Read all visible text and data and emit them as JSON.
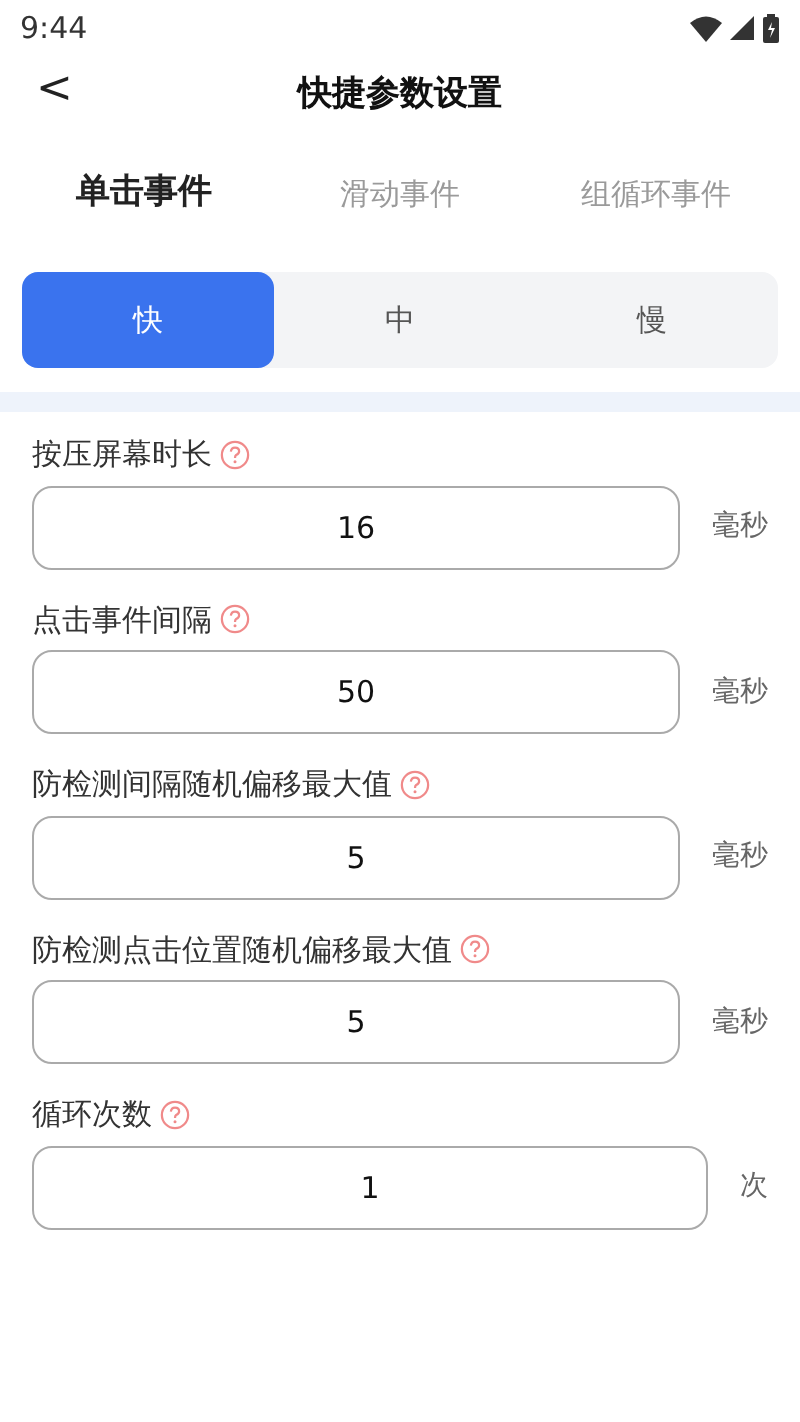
{
  "status_bar": {
    "time": "9:44"
  },
  "header": {
    "back": "<",
    "title": "快捷参数设置"
  },
  "tabs": [
    {
      "label": "单击事件",
      "selected": true
    },
    {
      "label": "滑动事件",
      "selected": false
    },
    {
      "label": "组循环事件",
      "selected": false
    }
  ],
  "speed": [
    {
      "label": "快",
      "selected": true
    },
    {
      "label": "中",
      "selected": false
    },
    {
      "label": "慢",
      "selected": false
    }
  ],
  "fields": [
    {
      "label": "按压屏幕时长",
      "value": "16",
      "unit": "毫秒"
    },
    {
      "label": "点击事件间隔",
      "value": "50",
      "unit": "毫秒"
    },
    {
      "label": "防检测间隔随机偏移最大值",
      "value": "5",
      "unit": "毫秒"
    },
    {
      "label": "防检测点击位置随机偏移最大值",
      "value": "5",
      "unit": "毫秒"
    },
    {
      "label": "循环次数",
      "value": "1",
      "unit": "次"
    }
  ]
}
